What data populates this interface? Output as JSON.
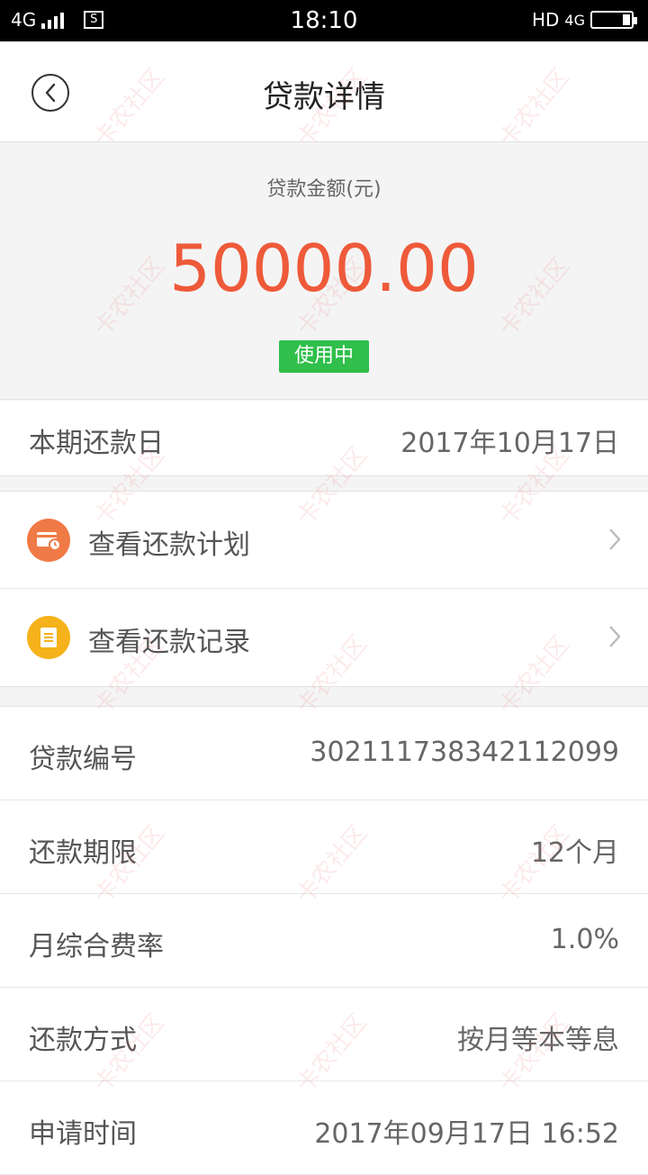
{
  "status_bar": {
    "network": "4G",
    "time": "18:10",
    "hd": "HD",
    "network_right": "4G",
    "sim_glyph": "S"
  },
  "header": {
    "title": "贷款详情",
    "back_icon": "chevron-left-circle-icon"
  },
  "loan": {
    "amount_label": "贷款金额(元)",
    "amount": "50000.00",
    "status": "使用中",
    "due_label": "本期还款日",
    "due_date": "2017年10月17日"
  },
  "actions": [
    {
      "label": "查看还款计划",
      "icon": "calendar-card-icon",
      "color": "#f07a45"
    },
    {
      "label": "查看还款记录",
      "icon": "document-icon",
      "color": "#f5b21a"
    }
  ],
  "details": [
    {
      "label": "贷款编号",
      "value": "302111738342112099"
    },
    {
      "label": "还款期限",
      "value": "12个月"
    },
    {
      "label": "月综合费率",
      "value": "1.0%"
    },
    {
      "label": "还款方式",
      "value": "按月等本等息"
    },
    {
      "label": "申请时间",
      "value": "2017年09月17日 16:52"
    }
  ],
  "watermark_text": "卡农社区",
  "colors": {
    "accent": "#ee5a3a",
    "badge": "#2fbf4a"
  }
}
